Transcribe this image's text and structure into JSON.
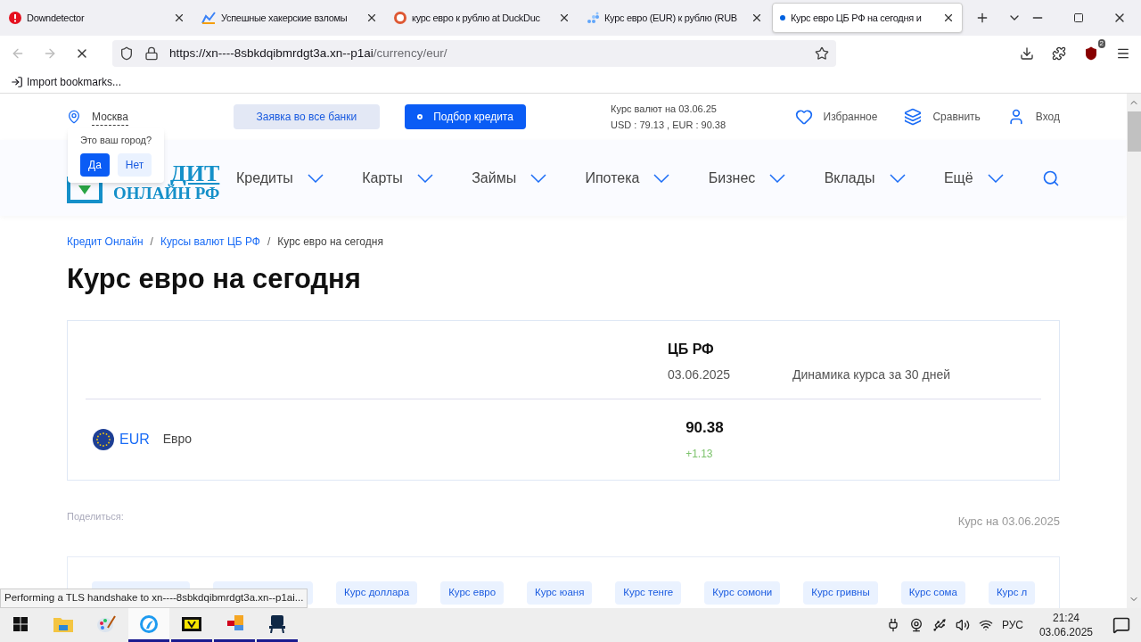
{
  "browser": {
    "tabs": [
      {
        "title": "Downdetector",
        "selected": false
      },
      {
        "title": "Успешные хакерские взломы",
        "selected": false
      },
      {
        "title": "курс евро к рублю at DuckDuc",
        "selected": false
      },
      {
        "title": "Курс евро (EUR) к рублю (RUB",
        "selected": false
      },
      {
        "title": "Курс евро ЦБ РФ на сегодня и",
        "selected": true
      }
    ],
    "url_host": "https://xn----8sbkdqibmrdgt3a.xn--p1ai",
    "url_path": "/currency/eur/",
    "extension_badge": "2",
    "bookmark": "Import bookmarks...",
    "status": "Performing a TLS handshake to xn----8sbkdqibmrdgt3a.xn--p1ai..."
  },
  "site": {
    "city": "Москва",
    "city_popup": {
      "question": "Это ваш город?",
      "yes": "Да",
      "no": "Нет"
    },
    "apply_button": "Заявка во все банки",
    "credit_button": "Подбор кредита",
    "rates_info": [
      "Курс валют на 03.06.25",
      "USD : 79.13 , EUR : 90.38"
    ],
    "links": [
      "Избранное",
      "Сравнить",
      "Вход"
    ],
    "logo": {
      "top": "ДИТ",
      "bottom": "ОНЛАЙН РФ"
    },
    "nav": [
      "Кредиты",
      "Карты",
      "Займы",
      "Ипотека",
      "Бизнес",
      "Вклады",
      "Ещё"
    ],
    "breadcrumbs": [
      {
        "label": "Кредит Онлайн",
        "link": true
      },
      {
        "separator": "/"
      },
      {
        "label": "Курсы валют ЦБ РФ",
        "link": true
      },
      {
        "separator": "/"
      },
      {
        "label": "Курс евро на сегодня",
        "link": false
      }
    ],
    "heading": "Курс евро на сегодня",
    "rate_card": {
      "source": "ЦБ РФ",
      "date": "03.06.2025",
      "dynamics": "Динамика курса за 30 дней",
      "code": "EUR",
      "name": "Евро",
      "rate": "90.38",
      "change": "+1.13"
    },
    "share": "Поделиться:",
    "rate_date": "Курс на 03.06.2025",
    "chips": [
      "Курс доллара",
      "Курс евро",
      "Курс юаня",
      "Курс тенге",
      "Курс сомони",
      "Курс гривны",
      "Курс сома",
      "Курс л"
    ]
  },
  "taskbar": {
    "apps": [
      {
        "running": false,
        "active": false
      },
      {
        "running": false,
        "active": false
      },
      {
        "running": false,
        "active": false
      },
      {
        "running": true,
        "active": true
      },
      {
        "running": true,
        "active": false
      },
      {
        "running": true,
        "active": false
      },
      {
        "running": true,
        "active": false
      }
    ],
    "language": "РУС",
    "time": "21:24",
    "date": "03.06.2025"
  }
}
